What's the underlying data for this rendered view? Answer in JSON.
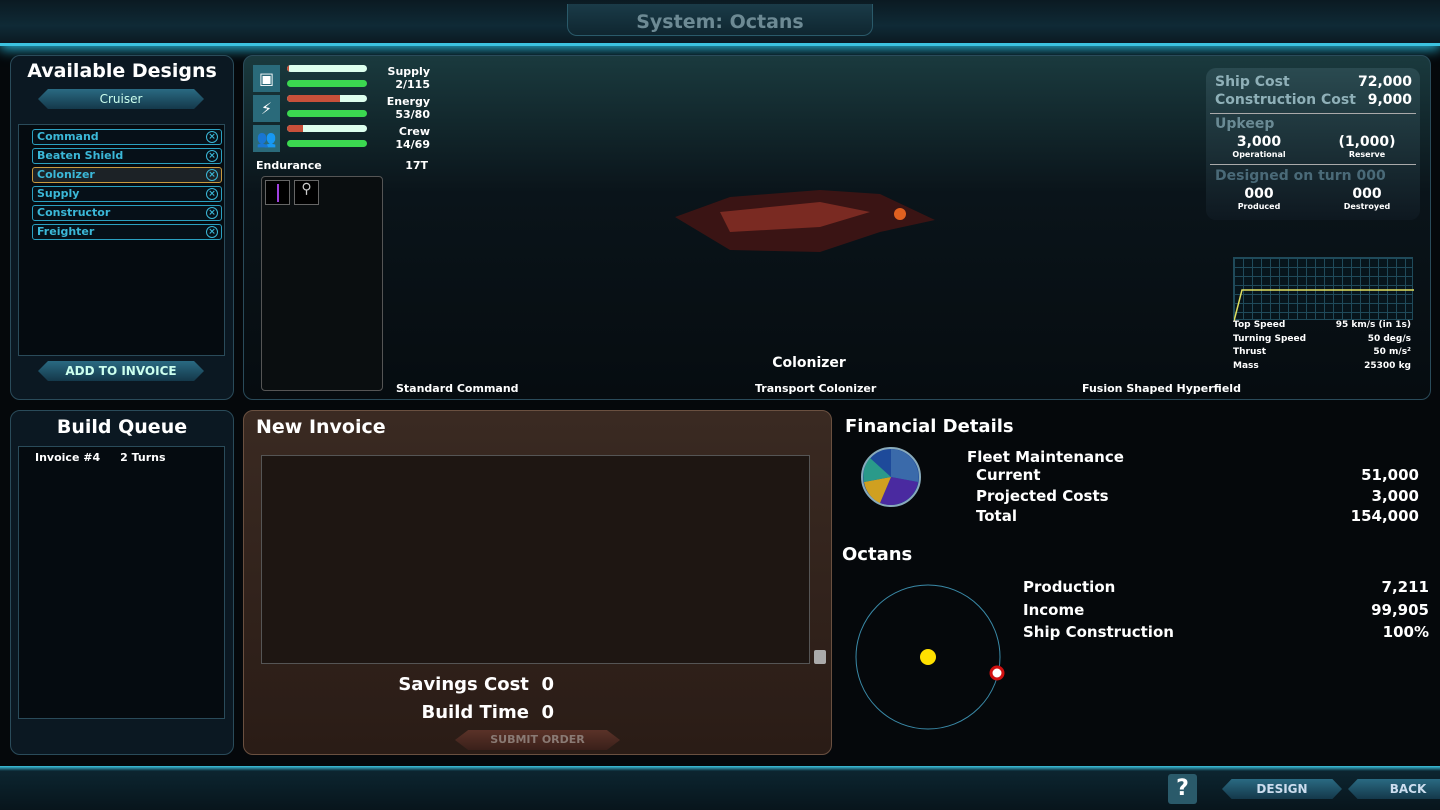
{
  "header": {
    "title": "System: Octans"
  },
  "available": {
    "title": "Available Designs",
    "class_tab": "Cruiser",
    "items": [
      "Command",
      "Beaten Shield",
      "Colonizer",
      "Supply",
      "Constructor",
      "Freighter"
    ],
    "selected": "Colonizer",
    "add_button": "ADD TO INVOICE"
  },
  "stats": {
    "supply": {
      "label": "Supply",
      "value": "2/115",
      "fill": 0.02
    },
    "energy": {
      "label": "Energy",
      "value": "53/80",
      "fill": 0.66
    },
    "crew": {
      "label": "Crew",
      "value": "14/69",
      "fill": 0.2
    },
    "endurance_label": "Endurance",
    "endurance": "17T"
  },
  "ship": {
    "name": "Colonizer",
    "slot_left": "Standard Command",
    "slot_mid": "Transport Colonizer",
    "slot_right": "Fusion Shaped Hyperfield"
  },
  "cost": {
    "ship_cost_label": "Ship Cost",
    "ship_cost": "72,000",
    "construction_label": "Construction Cost",
    "construction": "9,000",
    "upkeep_label": "Upkeep",
    "operational": "3,000",
    "operational_label": "Operational",
    "reserve": "(1,000)",
    "reserve_label": "Reserve",
    "designed_label": "Designed on turn 000",
    "produced": "000",
    "produced_label": "Produced",
    "destroyed": "000",
    "destroyed_label": "Destroyed"
  },
  "perf": {
    "rows": [
      {
        "label": "Top Speed",
        "value": "95 km/s (in 1s)"
      },
      {
        "label": "Turning Speed",
        "value": "50 deg/s"
      },
      {
        "label": "Thrust",
        "value": "50 m/s²"
      },
      {
        "label": "Mass",
        "value": "25300 kg"
      }
    ]
  },
  "queue": {
    "title": "Build Queue",
    "invoice": "Invoice #4",
    "turns": "2 Turns"
  },
  "invoice": {
    "title": "New Invoice",
    "savings_label": "Savings Cost",
    "savings": "0",
    "time_label": "Build Time",
    "time": "0",
    "submit": "SUBMIT ORDER"
  },
  "financial": {
    "title": "Financial Details",
    "section": "Fleet Maintenance",
    "rows": [
      {
        "label": "Current",
        "value": "51,000"
      },
      {
        "label": "Projected Costs",
        "value": "3,000"
      },
      {
        "label": "Total",
        "value": "154,000"
      }
    ]
  },
  "system": {
    "title": "Octans",
    "rows": [
      {
        "label": "Production",
        "value": "7,211"
      },
      {
        "label": "Income",
        "value": "99,905"
      },
      {
        "label": "Ship Construction",
        "value": "100%"
      }
    ]
  },
  "footer": {
    "help": "?",
    "design": "DESIGN",
    "back": "BACK"
  }
}
